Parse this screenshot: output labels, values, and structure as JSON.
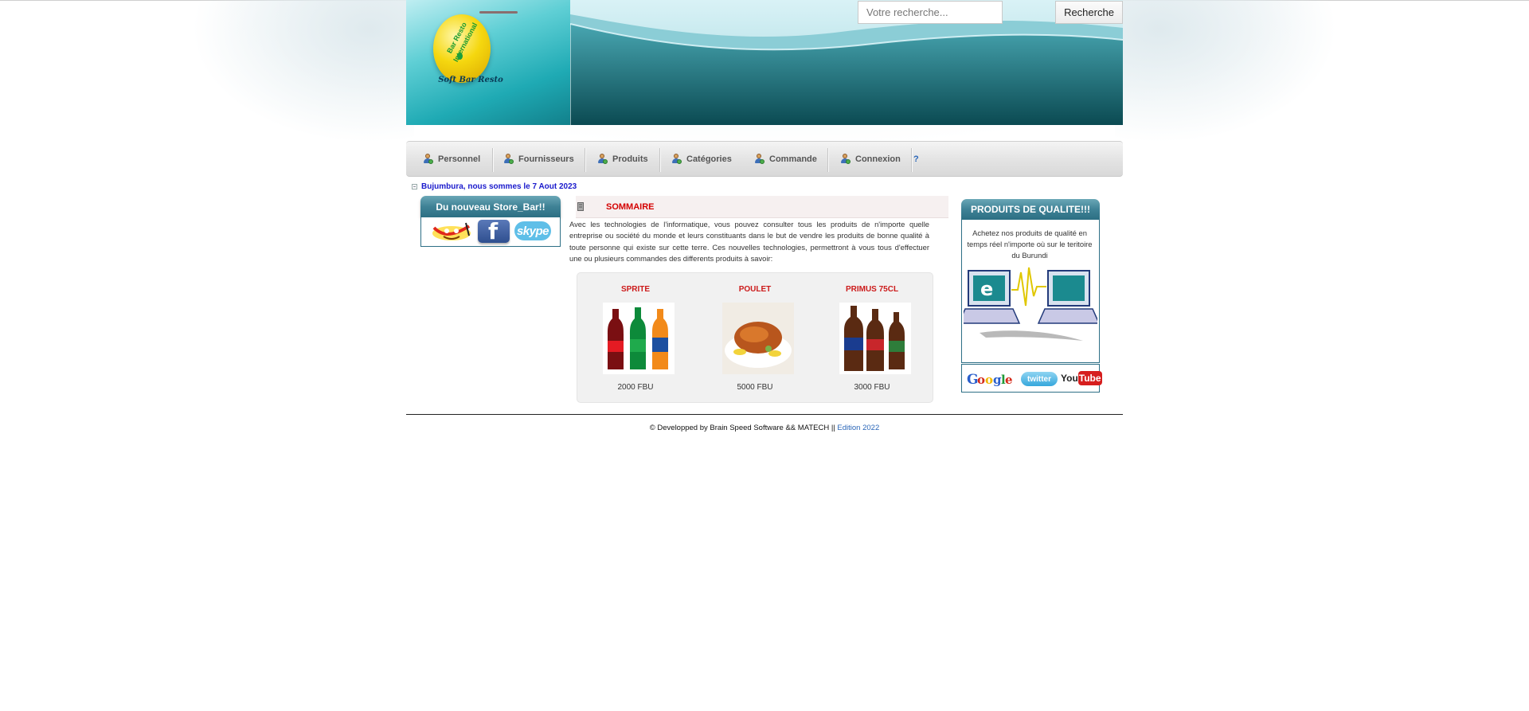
{
  "header": {
    "logo_text": "Bar Resto International",
    "logo_caption": "Soft Bar Resto"
  },
  "search": {
    "placeholder": "Votre recherche...",
    "button_label": "Recherche"
  },
  "nav": {
    "items": [
      {
        "label": "Personnel",
        "icon": "user-group-icon"
      },
      {
        "label": "Fournisseurs",
        "icon": "user-group-icon"
      },
      {
        "label": "Produits",
        "icon": "user-group-icon"
      },
      {
        "label": "Catégories",
        "icon": "user-group-icon"
      },
      {
        "label": "Commande",
        "icon": "user-group-icon"
      },
      {
        "label": "Connexion",
        "icon": "user-group-icon"
      }
    ],
    "help_label": "?"
  },
  "date_line": "Bujumbura, nous sommes le 7 Aout 2023",
  "left_box": {
    "title": "Du nouveau Store_Bar!!",
    "icons": [
      "yahoo-icon",
      "facebook-icon",
      "skype-icon"
    ],
    "skype_label": "skype",
    "facebook_label": "f"
  },
  "main": {
    "section_title": "SOMMAIRE",
    "intro": "Avec les technologies de l'informatique, vous pouvez consulter tous les produits de n'importe quelle entreprise ou société du monde et leurs constituants dans le but de vendre les produits de bonne qualité à toute personne qui existe sur cette terre. Ces nouvelles technologies, permettront à vous tous d'effectuer une ou plusieurs commandes des differents produits à savoir:",
    "products": [
      {
        "name": "SPRITE",
        "price": "2000 FBU",
        "image": "soda-bottles-image"
      },
      {
        "name": "POULET",
        "price": "5000 FBU",
        "image": "roast-chicken-image"
      },
      {
        "name": "PRIMUS 75CL",
        "price": "3000 FBU",
        "image": "beer-bottles-image"
      }
    ]
  },
  "right_box": {
    "title": "PRODUITS DE QUALITE!!!",
    "text": "Achetez nos produits de qualité en temps réel n'importe où sur le teritoire du Burundi",
    "social": [
      "google-logo",
      "twitter-logo",
      "youtube-logo"
    ],
    "google_label": "Google",
    "twitter_label": "twitter",
    "youtube_label": "YouTube"
  },
  "footer": {
    "text": "© Developped by Brain Speed Software && MATECH || ",
    "link": "Edition 2022"
  },
  "colors": {
    "accent_red": "#d40000",
    "box_header": "#3f8296",
    "link_blue": "#2a66b8",
    "date_blue": "#1a1acc"
  }
}
